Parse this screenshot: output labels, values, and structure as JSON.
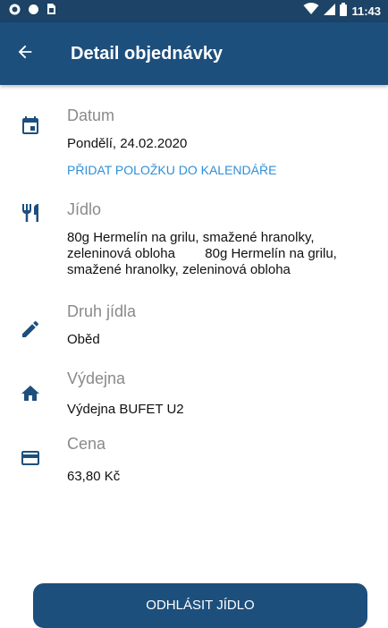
{
  "status_bar": {
    "time": "11:43",
    "icons": [
      "circle-icon",
      "circle-icon",
      "sim-card-icon",
      "wifi-icon",
      "signal-icon",
      "battery-icon"
    ]
  },
  "app_bar": {
    "title": "Detail objednávky",
    "back_icon": "arrow-back-icon"
  },
  "details": {
    "date": {
      "icon": "calendar-icon",
      "label": "Datum",
      "value": "Pondělí, 24.02.2020",
      "action": "PŘIDAT POLOŽKU DO KALENDÁŘE"
    },
    "food": {
      "icon": "restaurant-icon",
      "label": "Jídlo",
      "value_lines": [
        "80g Hermelín na grilu, smažené hranolky,",
        "zeleninová obloha        80g Hermelín na grilu,",
        "smažené hranolky, zeleninová obloha"
      ]
    },
    "meal_type": {
      "icon": "pencil-icon",
      "label": "Druh jídla",
      "value": "Oběd"
    },
    "canteen": {
      "icon": "home-icon",
      "label": "Výdejna",
      "value": "Výdejna BUFET U2"
    },
    "price": {
      "icon": "credit-card-icon",
      "label": "Cena",
      "value": "63,80 Kč"
    }
  },
  "actions": {
    "cancel_label": "ODHLÁSIT JÍDLO"
  },
  "colors": {
    "status_bar": "#1d4366",
    "app_bar": "#1d4f7d",
    "icon": "#1d4f7d",
    "link": "#2f8fd8",
    "label": "#8a8a8a"
  }
}
